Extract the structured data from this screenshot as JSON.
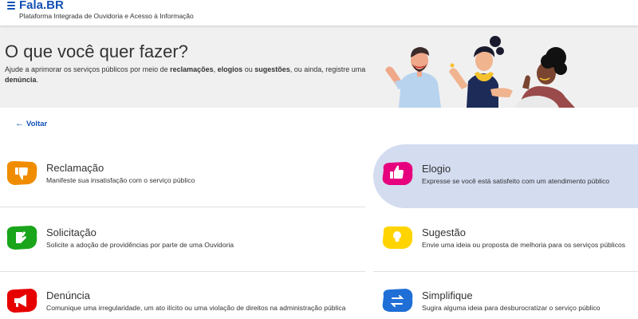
{
  "header": {
    "brand": "Fala.BR",
    "subtitle": "Plataforma Integrada de Ouvidoria e Acesso à Informação"
  },
  "hero": {
    "title": "O que você quer fazer?",
    "description_parts": {
      "p1": "Ajude a aprimorar os serviços públicos por meio de ",
      "b1": "reclamações",
      "p2": ", ",
      "b2": "elogios",
      "p3": " ou ",
      "b3": "sugestões",
      "p4": ", ou ainda, registre uma ",
      "b4": "denúncia",
      "p5": "."
    }
  },
  "back_link": {
    "label": "Voltar",
    "icon": "arrow-left-icon"
  },
  "cards": {
    "reclamacao": {
      "title": "Reclamação",
      "description": "Manifeste sua insatisfação com o serviço público",
      "icon": "thumbs-down-icon",
      "color": "#f08c00"
    },
    "elogio": {
      "title": "Elogio",
      "description": "Expresse se você está satisfeito com um atendimento público",
      "icon": "thumbs-up-icon",
      "color": "#e6007e",
      "selected": true
    },
    "solicitacao": {
      "title": "Solicitação",
      "description": "Solicite a adoção de providências por parte de uma Ouvidoria",
      "icon": "hand-pointer-icon",
      "color": "#1aa51a"
    },
    "sugestao": {
      "title": "Sugestão",
      "description": "Envie uma ideia ou proposta de melhoria para os serviços públicos",
      "icon": "lightbulb-icon",
      "color": "#ffd400"
    },
    "denuncia": {
      "title": "Denúncia",
      "description": "Comunique uma irregularidade, um ato ilícito ou uma violação de direitos na administração pública",
      "icon": "megaphone-icon",
      "color": "#e60000"
    },
    "simplifique": {
      "title": "Simplifique",
      "description": "Sugira alguma ideia para desburocratizar o serviço público",
      "icon": "arrows-exchange-icon",
      "color": "#1f6fd6"
    }
  },
  "colors": {
    "brand_blue": "#1351b4",
    "hero_bg": "#f0f0f0",
    "selected_bg": "#d4dcf0"
  }
}
